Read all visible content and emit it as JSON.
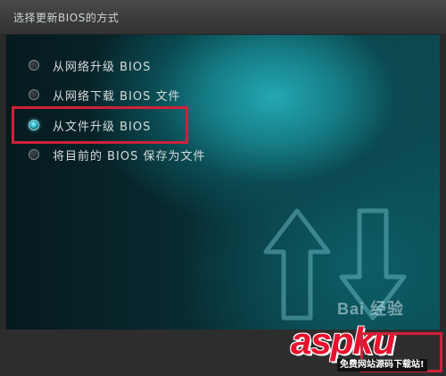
{
  "dialog": {
    "title": "选择更新BIOS的方式"
  },
  "options": [
    {
      "label": "从网络升级 BIOS",
      "selected": false
    },
    {
      "label": "从网络下载 BIOS 文件",
      "selected": false
    },
    {
      "label": "从文件升级 BIOS",
      "selected": true
    },
    {
      "label": "将目前的 BIOS 保存为文件",
      "selected": false
    }
  ],
  "watermarks": {
    "baidu": "Bai 经验",
    "site_logo": "aspku",
    "site_slogan": "免费网站源码下载站!"
  },
  "colors": {
    "accent": "#23a8b3",
    "highlight": "#d0213a",
    "text": "#d7dcdc"
  }
}
